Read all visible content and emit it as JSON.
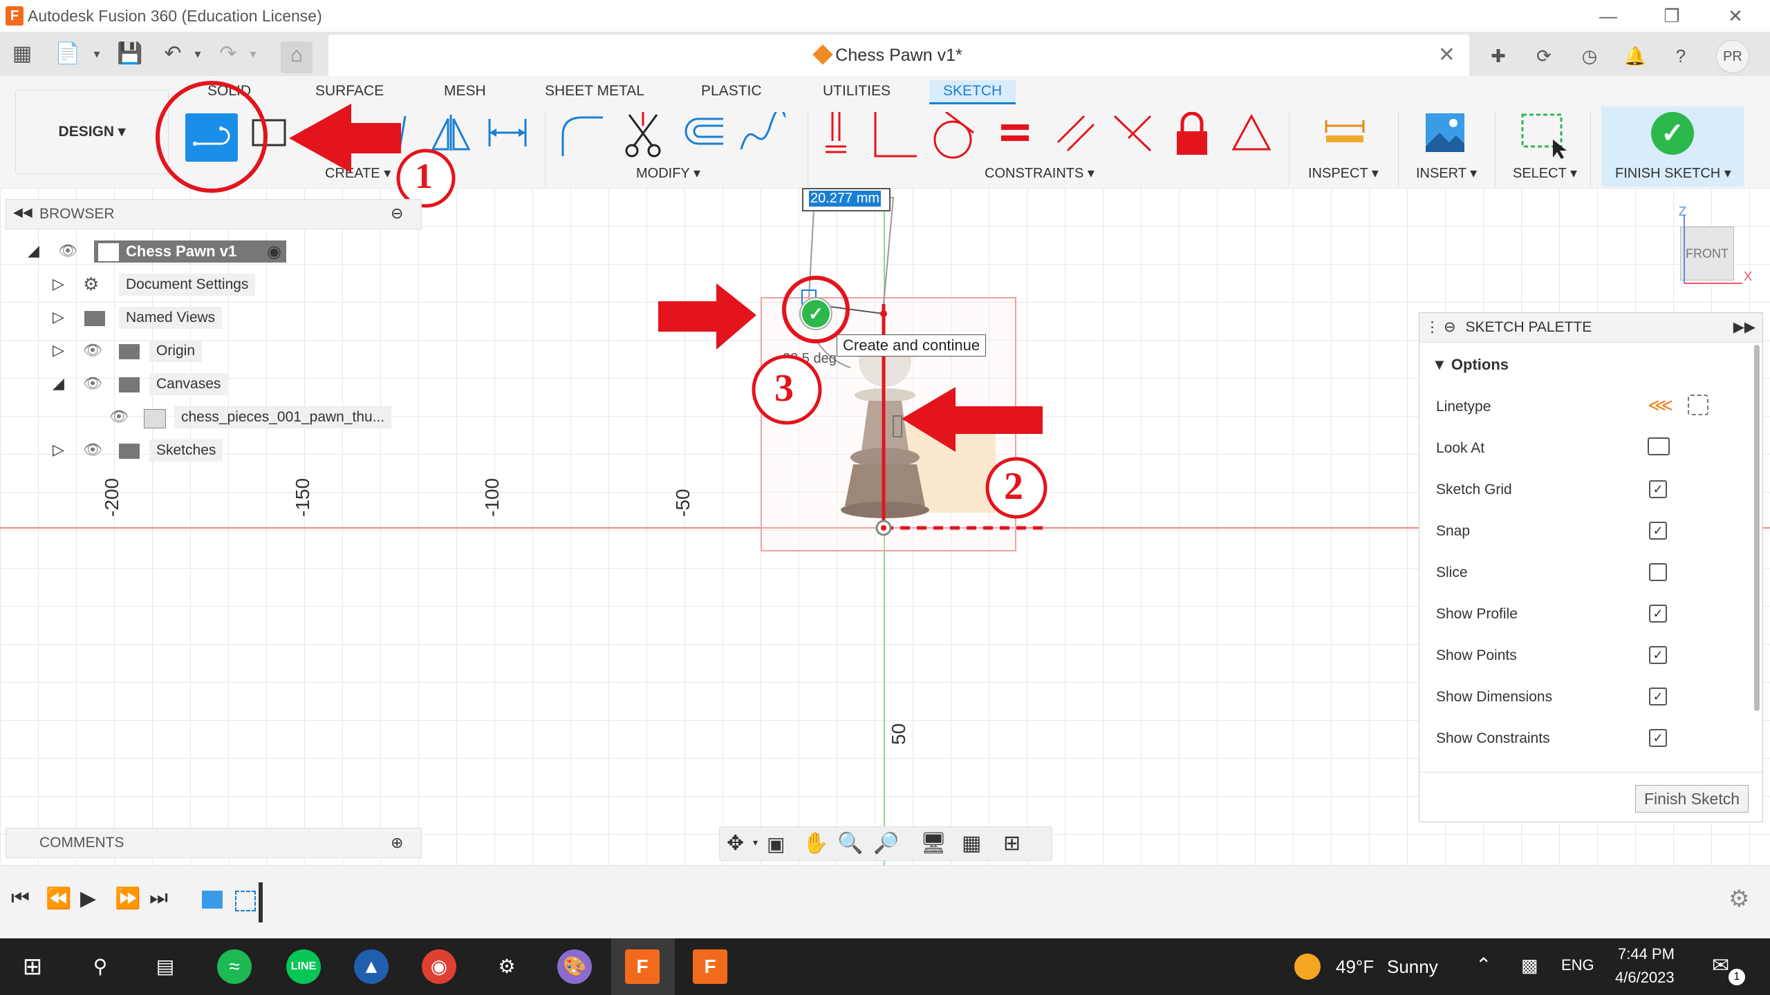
{
  "window": {
    "title": "Autodesk Fusion 360 (Education License)",
    "app_logo": "F"
  },
  "document": {
    "tab_title": "Chess Pawn v1*",
    "user_initials": "PR"
  },
  "ribbon": {
    "design_label": "DESIGN ▾",
    "tabs": [
      "SOLID",
      "SURFACE",
      "MESH",
      "SHEET METAL",
      "PLASTIC",
      "UTILITIES",
      "SKETCH"
    ],
    "active_tab": "SKETCH",
    "groups": {
      "create": "CREATE ▾",
      "modify": "MODIFY ▾",
      "constraints": "CONSTRAINTS ▾",
      "inspect": "INSPECT ▾",
      "insert": "INSERT ▾",
      "select": "SELECT ▾",
      "finish_sketch": "FINISH SKETCH ▾"
    }
  },
  "browser": {
    "title": "BROWSER",
    "root": "Chess Pawn v1",
    "items": [
      {
        "label": "Document Settings",
        "icon": "gear-icon"
      },
      {
        "label": "Named Views",
        "icon": "folder-icon"
      },
      {
        "label": "Origin",
        "icon": "folder-icon"
      },
      {
        "label": "Canvases",
        "icon": "folder-icon"
      },
      {
        "label": "chess_pieces_001_pawn_thu...",
        "icon": "image-icon"
      },
      {
        "label": "Sketches",
        "icon": "folder-icon"
      }
    ]
  },
  "canvas": {
    "ruler_labels": [
      "-200",
      "-150",
      "-100",
      "-50",
      "50"
    ],
    "dimension_input": "20.277 mm",
    "angle_label": "33.5 deg",
    "tooltip": "Create and continue",
    "viewcube_face": "FRONT",
    "axis_z": "Z",
    "axis_x": "X"
  },
  "annotations": {
    "marker_1": "1",
    "marker_2": "2",
    "marker_3": "3",
    "color": "#e3141c"
  },
  "palette": {
    "title": "SKETCH PALETTE",
    "section": "Options",
    "rows": [
      {
        "label": "Linetype"
      },
      {
        "label": "Look At"
      },
      {
        "label": "Sketch Grid",
        "checked": "✓"
      },
      {
        "label": "Snap",
        "checked": "✓"
      },
      {
        "label": "Slice",
        "checked": ""
      },
      {
        "label": "Show Profile",
        "checked": "✓"
      },
      {
        "label": "Show Points",
        "checked": "✓"
      },
      {
        "label": "Show Dimensions",
        "checked": "✓"
      },
      {
        "label": "Show Constraints",
        "checked": "✓"
      }
    ],
    "finish_button": "Finish Sketch"
  },
  "comments": {
    "title": "COMMENTS"
  },
  "taskbar": {
    "weather_temp": "49°F",
    "weather_desc": "Sunny",
    "language": "ENG",
    "time": "7:44 PM",
    "date": "4/6/2023",
    "notification_count": "1",
    "fusion_label": "F"
  },
  "colors": {
    "accent": "#1a7fd4",
    "annotation_red": "#e3141c",
    "sketch_red": "#e3141c",
    "finish_green": "#2db84c"
  }
}
